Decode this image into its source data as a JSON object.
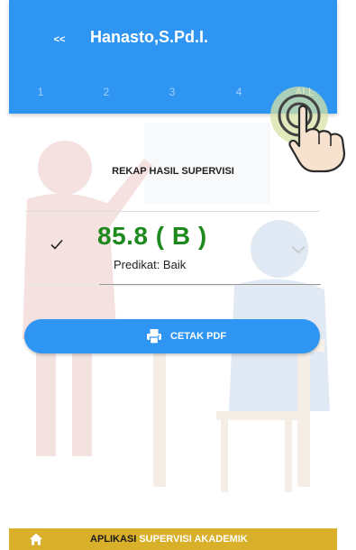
{
  "header": {
    "back_label": "<<",
    "title": "Hanasto,S.Pd.I.",
    "tabs": [
      "1",
      "2",
      "3",
      "4",
      "ALL"
    ],
    "active_tab": "ALL"
  },
  "main": {
    "section_title": "REKAP HASIL SUPERVISI",
    "score": "85.8 ( B )",
    "predikat": "Predikat: Baik",
    "print_button_label": "CETAK PDF"
  },
  "footer": {
    "app_label_part1": "APLIKASI",
    "app_label_part2": "SUPERVISI AKADEMIK"
  },
  "icons": {
    "back": "double-chevron-left-icon",
    "check": "check-icon",
    "expand": "chevron-down-icon",
    "print": "printer-icon",
    "home": "home-icon",
    "gesture": "tap-gesture-icon"
  },
  "colors": {
    "primary": "#2f95f3",
    "score_green": "#1e8a1e",
    "footer_gold": "#d9b02a"
  }
}
